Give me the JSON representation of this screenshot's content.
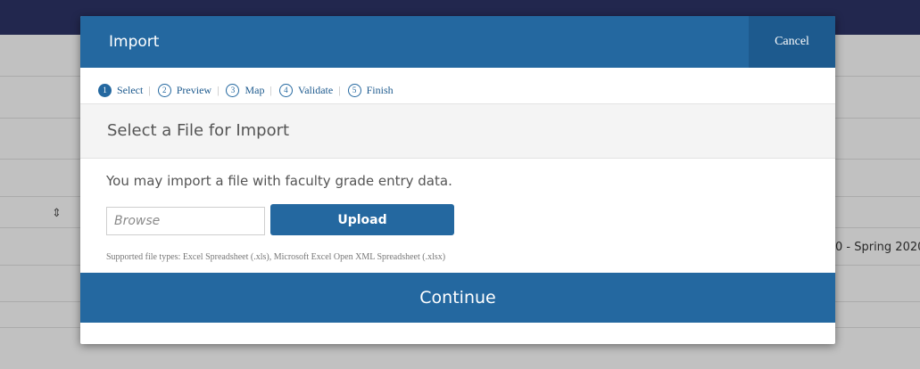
{
  "background": {
    "term_text": "0 - Spring 2020",
    "sort_icon": "sort-icon"
  },
  "modal": {
    "title": "Import",
    "cancel_label": "Cancel",
    "steps": [
      {
        "num": "1",
        "label": "Select",
        "active": true
      },
      {
        "num": "2",
        "label": "Preview",
        "active": false
      },
      {
        "num": "3",
        "label": "Map",
        "active": false
      },
      {
        "num": "4",
        "label": "Validate",
        "active": false
      },
      {
        "num": "5",
        "label": "Finish",
        "active": false
      }
    ],
    "section_title": "Select a File for Import",
    "intro": "You may import a file with faculty grade entry data.",
    "browse_placeholder": "Browse",
    "upload_label": "Upload",
    "supported": "Supported file types: Excel Spreadsheet (.xls), Microsoft Excel Open XML Spreadsheet (.xlsx)",
    "continue_label": "Continue"
  },
  "colors": {
    "primary": "#2468a0",
    "topbar": "#2b3162"
  }
}
